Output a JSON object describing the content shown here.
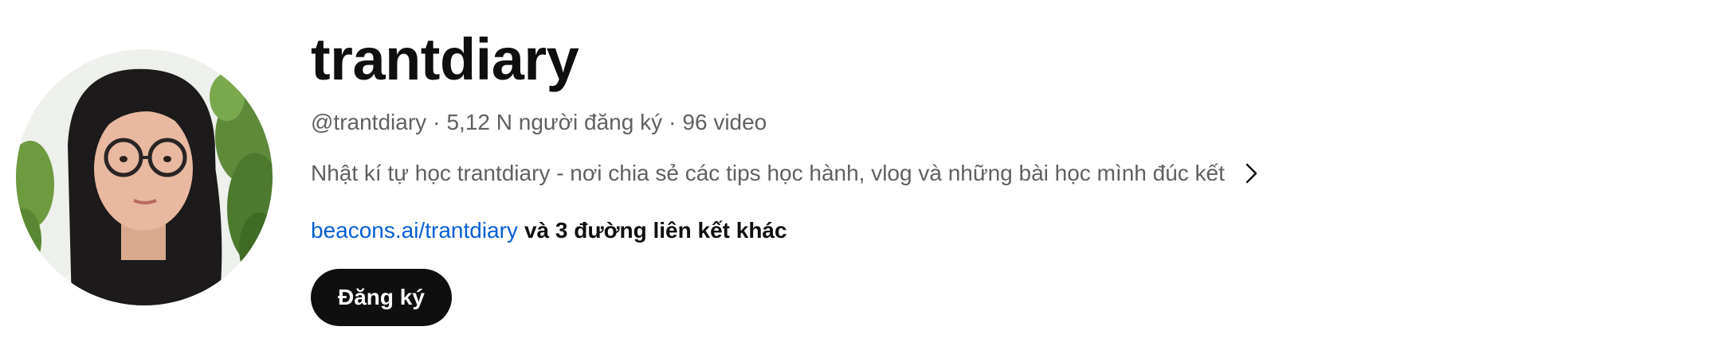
{
  "channel": {
    "name": "trantdiary",
    "handle": "@trantdiary",
    "separator": "·",
    "subscribers": "5,12 N người đăng ký",
    "videos": "96 video",
    "description": "Nhật kí tự học trantdiary - nơi chia sẻ các tips học hành, vlog và những bài học mình đúc kết",
    "description_more_icon": "chevron-right-icon",
    "link_text": "beacons.ai/trantdiary",
    "more_links_text": "và 3 đường liên kết khác",
    "subscribe_label": "Đăng ký",
    "avatar_icon": "channel-avatar-photo"
  },
  "colors": {
    "title": "#0f0f0f",
    "meta": "#606060",
    "link": "#065fd4",
    "button_bg": "#0f0f0f",
    "button_text": "#ffffff"
  }
}
